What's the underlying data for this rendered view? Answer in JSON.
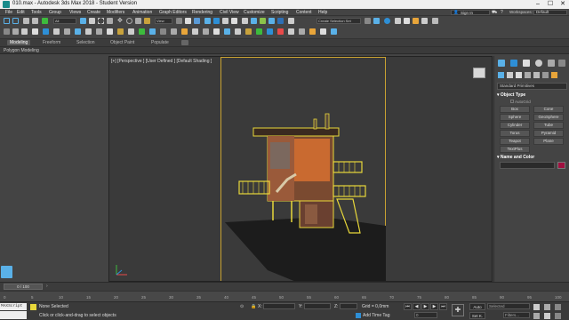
{
  "window": {
    "title": "010.max - Autodesk 3ds Max 2018 - Student Version",
    "controls": [
      "–",
      "☐",
      "✕"
    ]
  },
  "menu": [
    "File",
    "Edit",
    "Tools",
    "Group",
    "Views",
    "Create",
    "Modifiers",
    "Animation",
    "Graph Editors",
    "Rendering",
    "Civil View",
    "Customize",
    "Scripting",
    "Content",
    "Help"
  ],
  "signin": {
    "label": "Sign In",
    "workspaces_label": "Workspaces:",
    "workspace": "Default"
  },
  "toolbar": {
    "filter_dropdown": "All",
    "view_dropdown": "View",
    "selection_set": "Create Selection Set"
  },
  "ribbon": {
    "tabs": [
      "Modeling",
      "Freeform",
      "Selection",
      "Object Paint",
      "Populate"
    ],
    "active": "Modeling",
    "subtitle": "Polygon Modeling"
  },
  "viewport": {
    "label": "[+] [Perspective ] [User Defined ] [Default Shading ]"
  },
  "command_panel": {
    "dropdown": "Standard Primitives",
    "object_type_header": "Object Type",
    "autogrid": "AutoGrid",
    "buttons": [
      "Box",
      "Cone",
      "Sphere",
      "GeoSphere",
      "Cylinder",
      "Tube",
      "Torus",
      "Pyramid",
      "Teapot",
      "Plane",
      "TextPlus"
    ],
    "name_color_header": "Name and Color",
    "color": "#a01040"
  },
  "timeline": {
    "frame": "0 / 100",
    "ticks": [
      "0",
      "5",
      "10",
      "15",
      "20",
      "25",
      "30",
      "35",
      "40",
      "45",
      "50",
      "55",
      "60",
      "65",
      "70",
      "75",
      "80",
      "85",
      "90",
      "95",
      "100"
    ]
  },
  "status": {
    "script": "MAXScript Mi:",
    "selection": "None Selected",
    "prompt": "Click or click-and-drag to select objects",
    "x_label": "X:",
    "y_label": "Y:",
    "z_label": "Z:",
    "grid": "Grid = 0,0mm",
    "add_time_tag": "Add Time Tag",
    "auto": "Auto",
    "set_k": "Set K.",
    "selected": "Selected",
    "filters": "Filters...",
    "frame_value": "0"
  },
  "colors": {
    "accent": "#2e8fd6",
    "frame": "#c9a232",
    "selection_wire": "#e8d83a"
  }
}
